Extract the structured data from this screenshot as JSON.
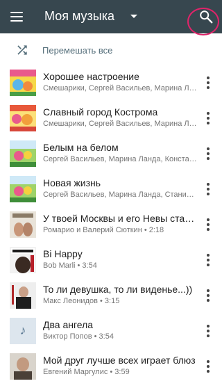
{
  "appbar": {
    "title": "Моя музыка",
    "background": "#37474f",
    "highlight_color": "#e0246a"
  },
  "shuffle": {
    "label": "Перемешать все",
    "icon": "shuffle-icon"
  },
  "tracks": [
    {
      "title": "Хорошее настроение",
      "subtitle": "Смешарики, Сергей Васильев, Марина Л…",
      "cover": "album-cover-smeshariki"
    },
    {
      "title": "Славный город Кострома",
      "subtitle": "Смешарики, Сергей Васильев, Марина Л…",
      "cover": "album-cover-smeshariki"
    },
    {
      "title": "Белым на белом",
      "subtitle": "Сергей Васильев, Марина Ланда, Конста…",
      "cover": "album-cover-smeshariki-green"
    },
    {
      "title": "Новая жизнь",
      "subtitle": "Сергей Васильев, Марина Ланда, Станис…",
      "cover": "album-cover-smeshariki-green"
    },
    {
      "title": "У твоей Москвы и его Невы стало…",
      "subtitle": "Ромарио и Валерий Сюткин • 2:18",
      "cover": "album-cover-romario"
    },
    {
      "title": "Bi Happy",
      "subtitle": "Bob Marli • 3:54",
      "cover": "album-cover-bob-marli"
    },
    {
      "title": "То ли девушка, то ли виденье...))",
      "subtitle": "Макс Леонидов • 3:15",
      "cover": "album-cover-leonidov"
    },
    {
      "title": "Два ангела",
      "subtitle": "Виктор Попов • 3:54",
      "cover": "music-note-icon"
    },
    {
      "title": "Мой друг лучше всех играет блюз",
      "subtitle": "Евгений Маргулис • 3:59",
      "cover": "album-cover-margulis"
    }
  ]
}
